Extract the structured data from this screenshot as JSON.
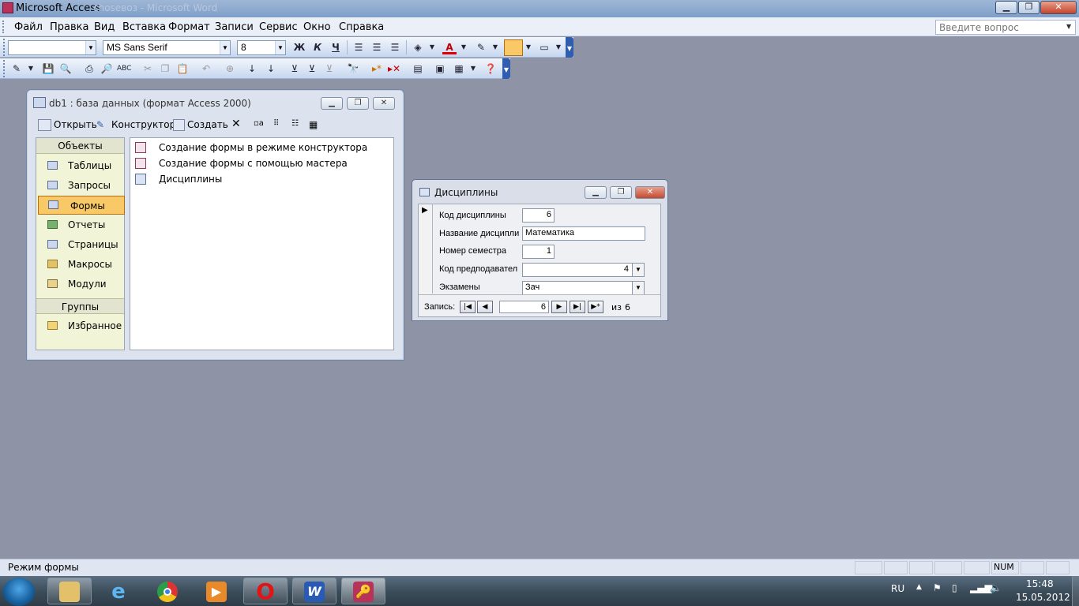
{
  "app": {
    "title": "Microsoft Access",
    "faded_title": "choseвоз - Microsoft Word"
  },
  "menu": [
    "Файл",
    "Правка",
    "Вид",
    "Вставка",
    "Формат",
    "Записи",
    "Сервис",
    "Окно",
    "Справка"
  ],
  "ask_placeholder": "Введите вопрос",
  "formatting": {
    "object_combo": "",
    "font": "MS Sans Serif",
    "size": "8",
    "bold": "Ж",
    "italic": "К",
    "underline": "Ч"
  },
  "db_window": {
    "title": "db1 : база данных (формат Access 2000)",
    "toolbar": {
      "open": "Открыть",
      "design": "Конструктор",
      "create": "Создать"
    },
    "objects_header": "Объекты",
    "objects": [
      "Таблицы",
      "Запросы",
      "Формы",
      "Отчеты",
      "Страницы",
      "Макросы",
      "Модули"
    ],
    "selected_object": "Формы",
    "groups_header": "Группы",
    "groups": [
      "Избранное"
    ],
    "list": [
      "Создание формы в режиме конструктора",
      "Создание формы с помощью мастера",
      "Дисциплины"
    ]
  },
  "form_window": {
    "title": "Дисциплины",
    "fields": [
      {
        "label": "Код дисциплины",
        "value": "6"
      },
      {
        "label": "Название дисципли",
        "value": "Математика"
      },
      {
        "label": "Номер семестра",
        "value": "1"
      },
      {
        "label": "Код предподавател",
        "value": "4"
      },
      {
        "label": "Экзамены",
        "value": "Зач"
      }
    ],
    "nav": {
      "label": "Запись:",
      "current": "6",
      "of_label": "из",
      "total": "6"
    }
  },
  "status": {
    "text": "Режим формы",
    "num": "NUM"
  },
  "taskbar": {
    "apps": [
      "explorer",
      "ie",
      "chrome",
      "media",
      "opera",
      "word",
      "access"
    ],
    "lang": "RU",
    "time": "15:48",
    "date": "15.05.2012"
  },
  "colors": {
    "desktop": "#8f93a6",
    "selection": "#f9c968",
    "taskbar": "#3c4d5b"
  }
}
